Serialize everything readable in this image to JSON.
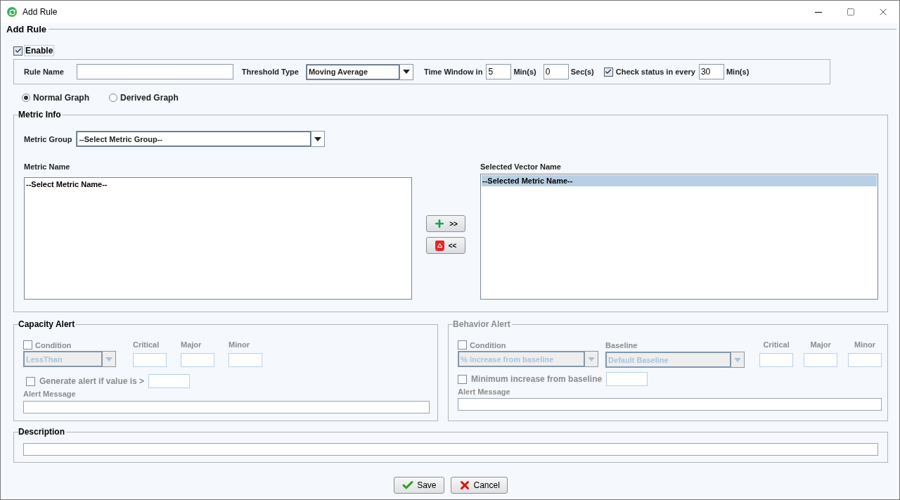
{
  "window": {
    "title": "Add Rule"
  },
  "panel": {
    "title": "Add Rule"
  },
  "enable": {
    "label": "Enable",
    "checked": true
  },
  "rule_name": {
    "label": "Rule Name"
  },
  "threshold_type": {
    "label": "Threshold Type",
    "value": "Moving Average"
  },
  "time_window": {
    "label": "Time Window in",
    "minutes": "5",
    "minutes_unit": "Min(s)",
    "seconds": "0",
    "seconds_unit": "Sec(s)"
  },
  "check_status": {
    "label": "Check status in every",
    "checked": true,
    "value": "30",
    "unit": "Min(s)"
  },
  "graph_types": [
    {
      "label": "Normal Graph",
      "selected": true
    },
    {
      "label": "Derived Graph",
      "selected": false
    }
  ],
  "metric_info": {
    "title": "Metric Info",
    "metric_group": {
      "label": "Metric Group",
      "value": "--Select Metric Group--"
    },
    "metric_name": {
      "label": "Metric Name",
      "items": [
        {
          "text": "--Select Metric Name--",
          "selected": false
        }
      ]
    },
    "selected_vector": {
      "label": "Selected Vector Name",
      "items": [
        {
          "text": "--Selected Metric Name--",
          "selected": true
        }
      ]
    },
    "add_button": ">>",
    "remove_button": "<<"
  },
  "capacity_alert": {
    "title": "Capacity Alert",
    "title_greyed": false,
    "disabled": true,
    "condition": {
      "label": "Condition",
      "checked": false,
      "value": "LessThan"
    },
    "levels": [
      "Critical",
      "Major",
      "Minor"
    ],
    "generate": {
      "label": "Generate alert if value is >",
      "checked": false
    },
    "alert_message": {
      "label": "Alert Message"
    }
  },
  "behavior_alert": {
    "title": "Behavior Alert",
    "title_greyed": true,
    "disabled": true,
    "condition": {
      "label": "Condition",
      "checked": false,
      "value": "% increase from baseline"
    },
    "baseline": {
      "label": "Baseline",
      "value": "Default Baseline"
    },
    "levels": [
      "Critical",
      "Major",
      "Minor"
    ],
    "minimum": {
      "label": "Minimum increase from baseline",
      "checked": false
    },
    "alert_message": {
      "label": "Alert Message"
    }
  },
  "description": {
    "title": "Description"
  },
  "buttons": [
    {
      "kind": "save",
      "label": "Save"
    },
    {
      "kind": "cancel",
      "label": "Cancel"
    }
  ]
}
